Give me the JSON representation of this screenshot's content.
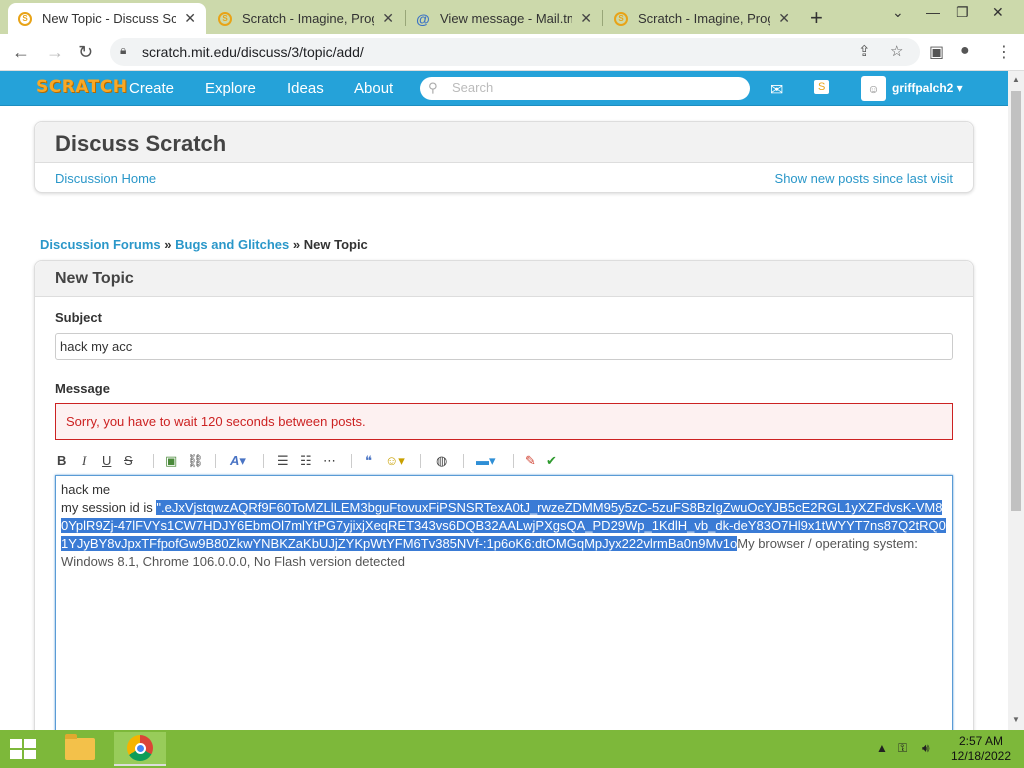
{
  "browser": {
    "tabs": [
      {
        "title": "New Topic - Discuss Scratch",
        "active": true,
        "icon": "scratch-favicon"
      },
      {
        "title": "Scratch - Imagine, Program",
        "active": false,
        "icon": "scratch-favicon"
      },
      {
        "title": "View message - Mail.tm",
        "active": false,
        "icon": "mail-at-favicon"
      },
      {
        "title": "Scratch - Imagine, Program",
        "active": false,
        "icon": "scratch-favicon"
      }
    ],
    "url": "scratch.mit.edu/discuss/3/topic/add/"
  },
  "scratch_nav": {
    "logo": "SCRATCH",
    "links": [
      "Create",
      "Explore",
      "Ideas",
      "About"
    ],
    "search_placeholder": "Search",
    "username": "griffpalch2"
  },
  "discuss": {
    "title": "Discuss Scratch",
    "home_link": "Discussion Home",
    "new_posts_link": "Show new posts since last visit"
  },
  "breadcrumb": {
    "forums": "Discussion Forums",
    "sep": "»",
    "category": "Bugs and Glitches",
    "current": "New Topic"
  },
  "form": {
    "heading": "New Topic",
    "subject_label": "Subject",
    "subject_value": "hack my acc",
    "message_label": "Message",
    "error": "Sorry, you have to wait 120 seconds between posts.",
    "toolbar": [
      "B",
      "I",
      "U",
      "S"
    ],
    "message_line1": "hack me",
    "message_prefix": "my session id is ",
    "message_selected": "\".eJxVjstqwzAQRf9F60ToMZLlLEM3bguFtovuxFiPSNSRTexA0tJ_rwzeZDMM95y5zC-5zuFS8BzIgZwuOcYJB5cE2RGL1yXZFdvsK-VM80YplR9Zj-47lFVYs1CW7HDJY6EbmOl7mlYtPG7yjixjXeqRET343vs6DQB32AALwjPXgsQA_PD29Wp_1KdlH_vb_dk-deY83O7Hl9x1tWYYT7ns87Q2tRQ01YJyBY8vJpxTFfpofGw9B80ZkwYNBKZaKbUJjZYKpWtYFM6Tv385NVf-:1p6oK6:dtOMGqMpJyx222vlrmBa0n9Mv1o",
    "message_suffix": "My browser / operating system: Windows 8.1, Chrome 106.0.0.0, No Flash version detected"
  },
  "taskbar": {
    "time": "2:57 AM",
    "date": "12/18/2022"
  }
}
